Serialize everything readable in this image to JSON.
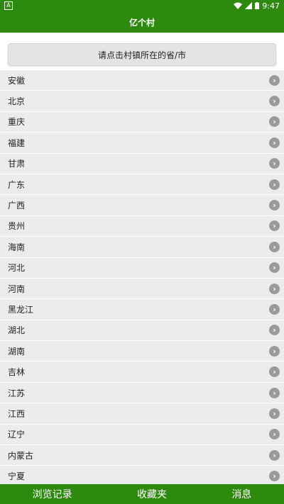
{
  "status": {
    "time": "9:47",
    "badge": "A"
  },
  "header": {
    "title": "亿个村"
  },
  "selector": {
    "label": "请点击村镇所在的省/市"
  },
  "provinces": [
    "安徽",
    "北京",
    "重庆",
    "福建",
    "甘肃",
    "广东",
    "广西",
    "贵州",
    "海南",
    "河北",
    "河南",
    "黑龙江",
    "湖北",
    "湖南",
    "吉林",
    "江苏",
    "江西",
    "辽宁",
    "内蒙古",
    "宁夏"
  ],
  "nav": {
    "history": "浏览记录",
    "favorites": "收藏夹",
    "messages": "消息"
  },
  "colors": {
    "brand": "#2e8a0f",
    "row_bg": "#ececec",
    "chevron": "#9a9a9a"
  }
}
